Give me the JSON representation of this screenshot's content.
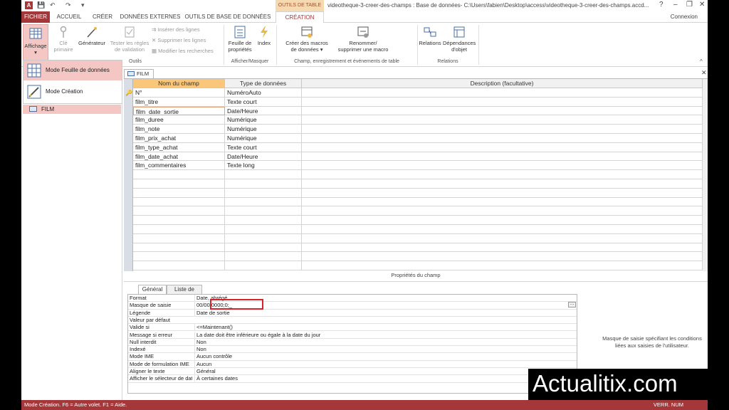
{
  "window": {
    "contextual_tab_group": "OUTILS DE TABLE",
    "title": "videotheque-3-creer-des-champs : Base de données- C:\\Users\\fabien\\Desktop\\access\\videotheque-3-creer-des-champs.accd...",
    "controls": [
      "?",
      "–",
      "❐",
      "✕"
    ]
  },
  "tabs": {
    "fichier": "FICHIER",
    "accueil": "ACCUEIL",
    "creer": "CRÉER",
    "donnees_externes": "DONNÉES EXTERNES",
    "outils_bdd": "OUTILS DE BASE DE DONNÉES",
    "creation": "CRÉATION",
    "connexion": "Connexion"
  },
  "ribbon": {
    "affichage": "Affichage",
    "cle_primaire": [
      "Clé",
      "primaire"
    ],
    "generateur": "Générateur",
    "tester_regles": [
      "Tester les règles",
      "de validation"
    ],
    "inserer_lignes": "Insérer des lignes",
    "supprimer_lignes": "Supprimer les lignes",
    "modifier_recherches": "Modifier les recherches",
    "group_outils": "Outils",
    "feuille_proprietes": [
      "Feuille de",
      "propriétés"
    ],
    "index": "Index",
    "group_afficher": "Afficher/Masquer",
    "creer_macros": [
      "Créer des macros",
      "de données ▾"
    ],
    "renommer_macro": [
      "Renommer/",
      "supprimer une macro"
    ],
    "group_champ": "Champ, enregistrement et événements de table",
    "relations": "Relations",
    "dependances": [
      "Dépendances",
      "d'objet"
    ],
    "group_relations": "Relations"
  },
  "dropdown": {
    "feuille_donnees": "Mode Feuille de données",
    "mode_creation": "Mode Création"
  },
  "navpane": {
    "film": "FILM"
  },
  "document": {
    "tab": "FILM",
    "headers": {
      "nom": "Nom du champ",
      "type": "Type de données",
      "desc": "Description (facultative)"
    },
    "fields": [
      {
        "name": "N°",
        "type": "NuméroAuto"
      },
      {
        "name": "film_titre",
        "type": "Texte court"
      },
      {
        "name": "film_date_sortie",
        "type": "Date/Heure"
      },
      {
        "name": "film_duree",
        "type": "Numérique"
      },
      {
        "name": "film_note",
        "type": "Numérique"
      },
      {
        "name": "film_prix_achat",
        "type": "Numérique"
      },
      {
        "name": "film_type_achat",
        "type": "Texte court"
      },
      {
        "name": "film_date_achat",
        "type": "Date/Heure"
      },
      {
        "name": "film_commentaires",
        "type": "Texte long"
      }
    ]
  },
  "properties": {
    "title": "Propriétés du champ",
    "tab_general": "Général",
    "tab_liste": "Liste de choix",
    "rows": [
      {
        "k": "Format",
        "v": "Date, abrégé"
      },
      {
        "k": "Masque de saisie",
        "v": "00/00/0000;0;_"
      },
      {
        "k": "Légende",
        "v": "Date de sortie"
      },
      {
        "k": "Valeur par défaut",
        "v": ""
      },
      {
        "k": "Valide si",
        "v": "<=Maintenant()"
      },
      {
        "k": "Message si erreur",
        "v": "La date doit être inférieure ou égale à la date du jour"
      },
      {
        "k": "Null interdit",
        "v": "Non"
      },
      {
        "k": "Indexé",
        "v": "Non"
      },
      {
        "k": "Mode IME",
        "v": "Aucun contrôle"
      },
      {
        "k": "Mode de formulation IME",
        "v": "Aucun"
      },
      {
        "k": "Aligner le texte",
        "v": "Général"
      },
      {
        "k": "Afficher le sélecteur de date",
        "v": "À certaines dates"
      }
    ],
    "help": "Masque de saisie spécifiant les conditions liées aux saisies de l'utilisateur."
  },
  "status": {
    "left": "Mode Création. F6 = Autre volet. F1 = Aide.",
    "right": "VERR. NUM"
  },
  "watermark": "Actualitix.com",
  "colors": {
    "accent": "#a4373a",
    "selected_pink": "#f4c7c4",
    "header_orange": "#f9c67a",
    "highlight_red": "#d6232a"
  }
}
